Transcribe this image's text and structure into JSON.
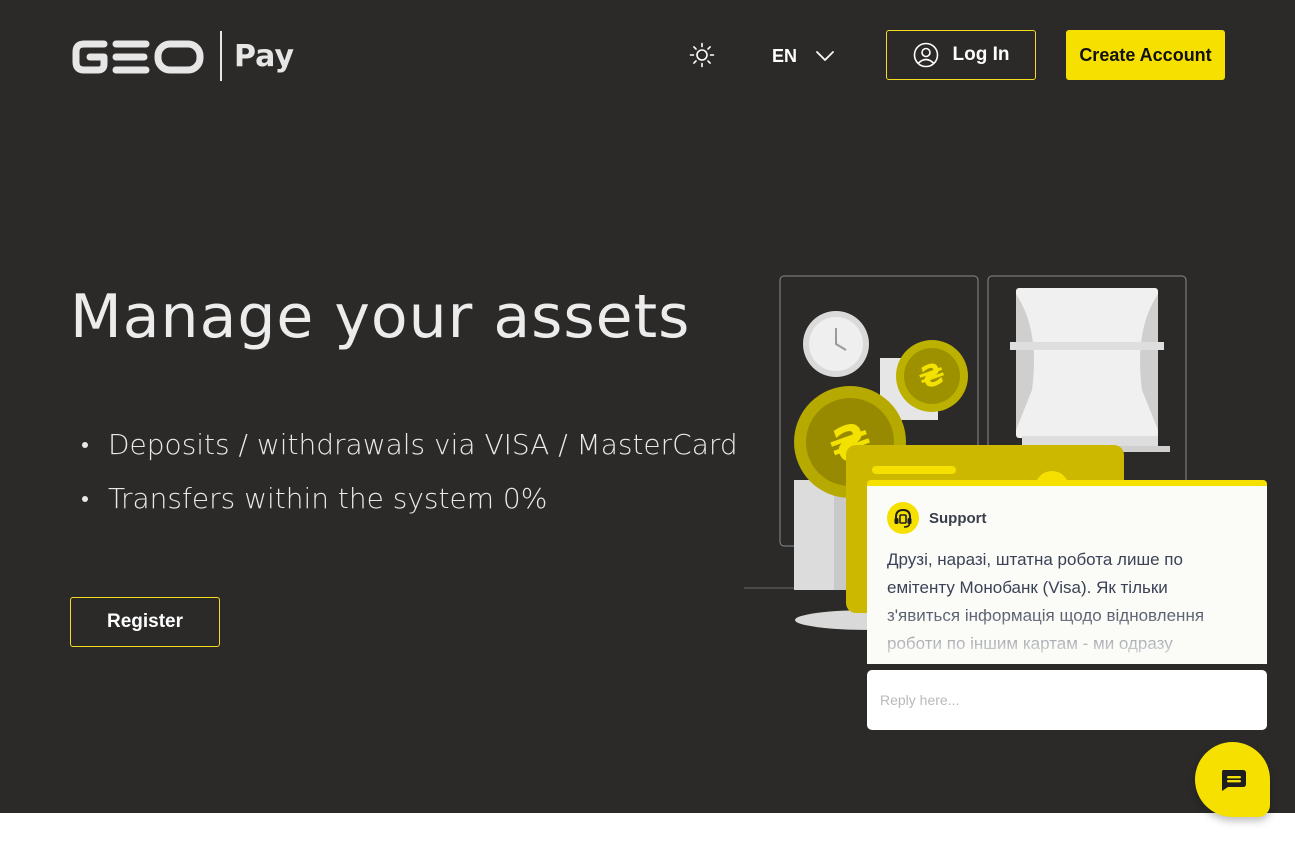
{
  "brand": {
    "logo_text": "GEO",
    "product": "Pay"
  },
  "header": {
    "language": "EN",
    "login_label": "Log In",
    "create_account_label": "Create Account"
  },
  "hero": {
    "title": "Manage your assets",
    "features": [
      "Deposits / withdrawals via VISA / MasterCard",
      "Transfers within the system 0%"
    ],
    "register_label": "Register"
  },
  "chat": {
    "agent_name": "Support",
    "message": "Друзі, наразі, штатна робота лише по емітенту Монобанк (Visa). Як тільки з'явиться інформація щодо відновлення роботи по іншим картам  - ми одразу",
    "reply_placeholder": "Reply here..."
  },
  "colors": {
    "accent": "#f6e000",
    "background": "#2b2a29",
    "text": "#ececec"
  },
  "icons": {
    "theme": "sun-icon",
    "language": "chevron-down-icon",
    "login": "user-icon",
    "chat_avatar": "headset-icon",
    "chat_launcher": "chat-bubble-icon"
  }
}
